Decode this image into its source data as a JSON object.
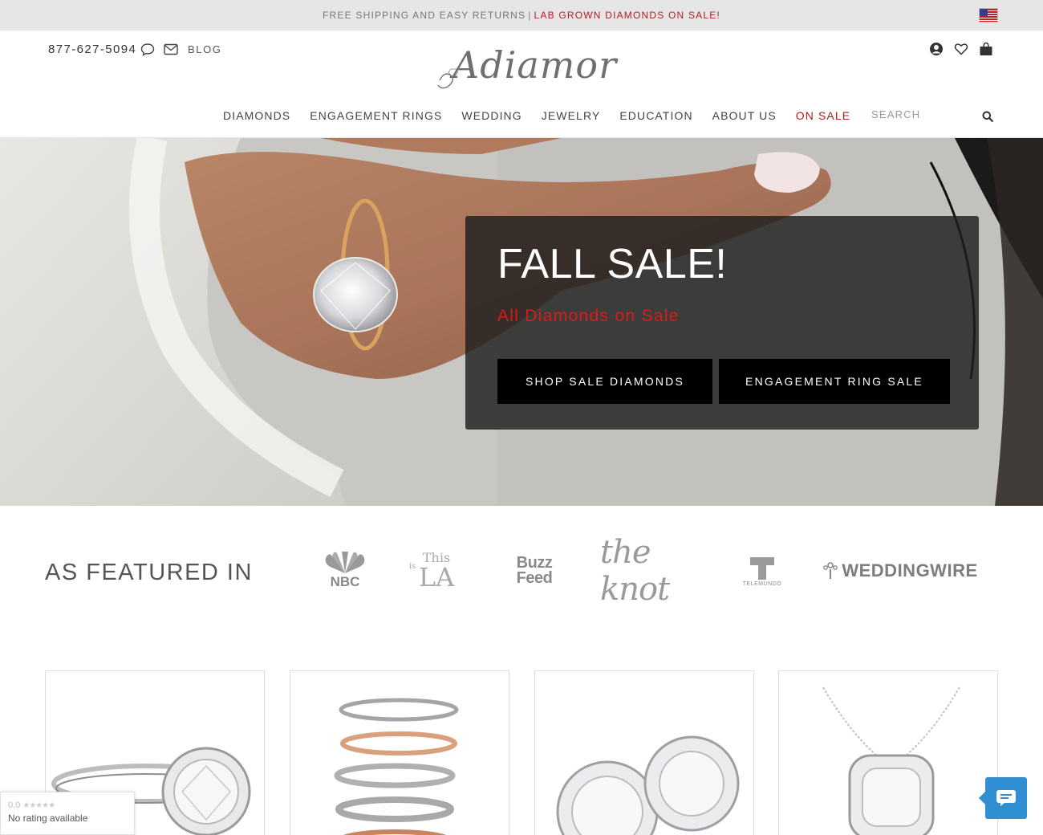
{
  "promo_bar": {
    "text": "FREE SHIPPING AND EASY RETURNS",
    "separator": "|",
    "highlight": "LAB GROWN DIAMONDS ON SALE!"
  },
  "header": {
    "phone": "877-627-5094",
    "blog_label": "BLOG",
    "logo_text": "Adiamor",
    "icons": [
      "chat-icon",
      "mail-icon",
      "account-icon",
      "heart-icon",
      "shopping-bag-icon",
      "search-icon",
      "us-flag-icon"
    ]
  },
  "nav": {
    "items": [
      {
        "label": "DIAMONDS"
      },
      {
        "label": "ENGAGEMENT RINGS"
      },
      {
        "label": "WEDDING"
      },
      {
        "label": "JEWELRY"
      },
      {
        "label": "EDUCATION"
      },
      {
        "label": "ABOUT US"
      },
      {
        "label": "ON SALE"
      }
    ],
    "search_placeholder": "SEARCH"
  },
  "hero": {
    "title": "FALL SALE!",
    "subtitle": "All Diamonds on Sale",
    "buttons": [
      {
        "label": "SHOP SALE DIAMONDS"
      },
      {
        "label": "ENGAGEMENT RING SALE"
      }
    ]
  },
  "featured": {
    "title": "AS FEATURED IN",
    "logos": {
      "nbc": "NBC",
      "la_top": "This",
      "la_is": "is",
      "la_main": "LA",
      "buzz_1": "Buzz",
      "buzz_2": "Feed",
      "knot": "the knot",
      "telemundo": "TELEMUNDO",
      "weddingwire": "WEDDINGWIRE"
    }
  },
  "rating_badge": {
    "score": "0.0",
    "stars": "★★★★★",
    "text": "No rating available"
  },
  "colors": {
    "accent_red": "#b0201c",
    "sale_red": "#dd1a1a",
    "chat_blue": "#2f8fd2"
  }
}
